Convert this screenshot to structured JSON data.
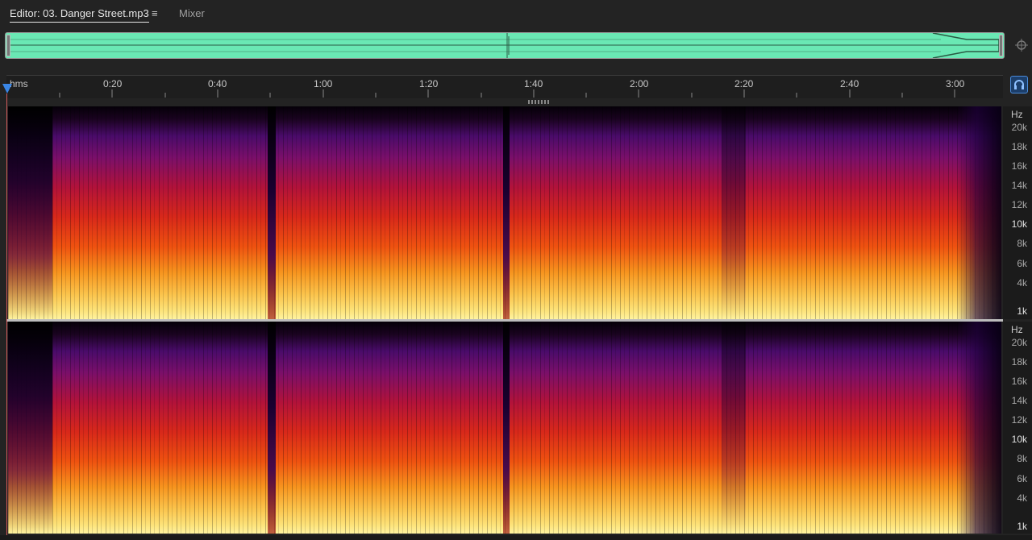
{
  "tabs": {
    "editor_label": "Editor: 03. Danger Street.mp3",
    "menu_glyph": "≡",
    "mixer_label": "Mixer"
  },
  "icons": {
    "zoom": "zoom-to-time-icon",
    "snap": "headphone-snap-icon"
  },
  "ruler": {
    "unit_label": "hms",
    "labels": [
      "0:20",
      "0:40",
      "1:00",
      "1:20",
      "1:40",
      "2:00",
      "2:20",
      "2:40",
      "3:00"
    ]
  },
  "hz_ruler": {
    "unit": "Hz",
    "labels": [
      "20k",
      "18k",
      "16k",
      "14k",
      "12k",
      "10k",
      "8k",
      "6k",
      "4k",
      "1k"
    ],
    "bold_labels": [
      "10k",
      "1k"
    ]
  },
  "colors": {
    "background": "#232323",
    "overview_wave": "#6ae8b4",
    "playhead": "#3a86e6",
    "spectrum_low": "#fff3a0",
    "spectrum_mid": "#d8281a",
    "spectrum_high": "#4a0b6a"
  }
}
